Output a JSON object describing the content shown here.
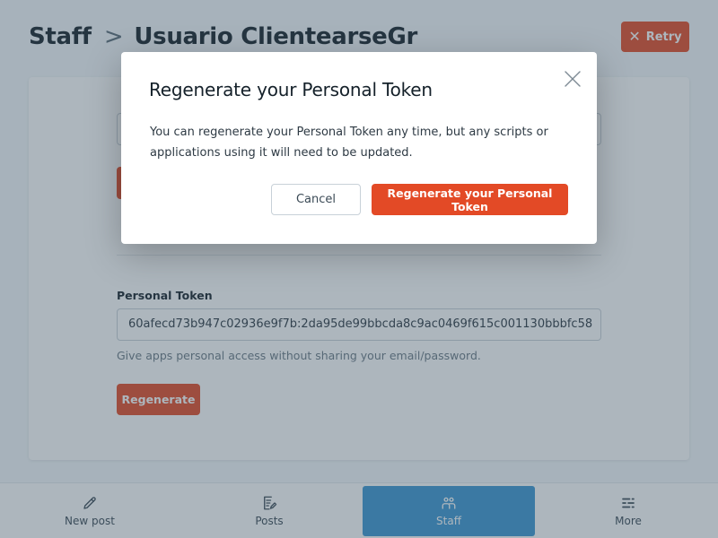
{
  "header": {
    "breadcrumb_root": "Staff",
    "breadcrumb_separator": ">",
    "breadcrumb_current": "Usuario ClientearseGr",
    "retry_label": "Retry"
  },
  "form": {
    "personal_token_label": "Personal Token",
    "personal_token_value": "60afecd73b947c02936e9f7b:2da95de99bbcda8c9ac0469f615c001130bbbfc58",
    "personal_token_help": "Give apps personal access without sharing your email/password.",
    "regenerate_label": "Regenerate"
  },
  "bottom_nav": {
    "items": [
      {
        "label": "New post",
        "icon": "pencil-icon"
      },
      {
        "label": "Posts",
        "icon": "posts-icon"
      },
      {
        "label": "Staff",
        "icon": "staff-icon"
      },
      {
        "label": "More",
        "icon": "more-icon"
      }
    ],
    "active": "Staff"
  },
  "modal": {
    "title": "Regenerate your Personal Token",
    "body": "You can regenerate your Personal Token any time, but any scripts or applications using it will need to be updated.",
    "cancel_label": "Cancel",
    "confirm_label": "Regenerate your Personal Token"
  },
  "colors": {
    "accent": "#e34a26",
    "nav_active": "#3b97d3",
    "overlay": "rgba(60, 80, 98, 0.42)"
  }
}
